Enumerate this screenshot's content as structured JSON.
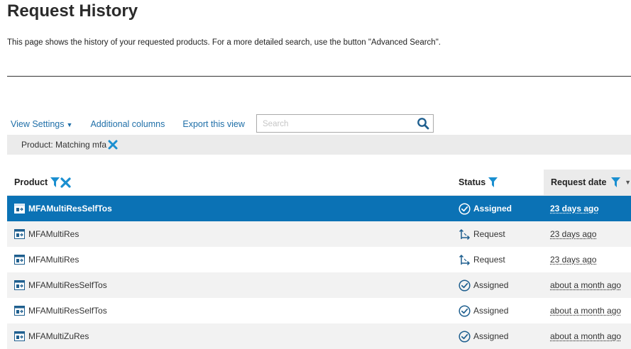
{
  "page": {
    "title": "Request History",
    "description": "This page shows the history of your requested products. For a more detailed search, use the button \"Advanced Search\"."
  },
  "toolbar": {
    "view_settings": "View Settings",
    "additional_columns": "Additional columns",
    "export_view": "Export this view",
    "search_placeholder": "Search"
  },
  "filter": {
    "chip_label": "Product: Matching mfa"
  },
  "table": {
    "headers": {
      "product": "Product",
      "status": "Status",
      "request_date": "Request date"
    },
    "rows": [
      {
        "product": "MFAMultiResSelfTos",
        "status": "Assigned",
        "status_icon": "check-circle-icon",
        "date": "23 days ago",
        "selected": true
      },
      {
        "product": "MFAMultiRes",
        "status": "Request",
        "status_icon": "request-arrows-icon",
        "date": "23 days ago"
      },
      {
        "product": "MFAMultiRes",
        "status": "Request",
        "status_icon": "request-arrows-icon",
        "date": "23 days ago"
      },
      {
        "product": "MFAMultiResSelfTos",
        "status": "Assigned",
        "status_icon": "check-circle-icon",
        "date": "about a month ago"
      },
      {
        "product": "MFAMultiResSelfTos",
        "status": "Assigned",
        "status_icon": "check-circle-icon",
        "date": "about a month ago"
      },
      {
        "product": "MFAMultiZuRes",
        "status": "Assigned",
        "status_icon": "check-circle-icon",
        "date": "about a month ago"
      }
    ]
  },
  "colors": {
    "accent": "#0b72b5",
    "link": "#1f6fa8",
    "filter_icon": "#1a8fd0"
  }
}
